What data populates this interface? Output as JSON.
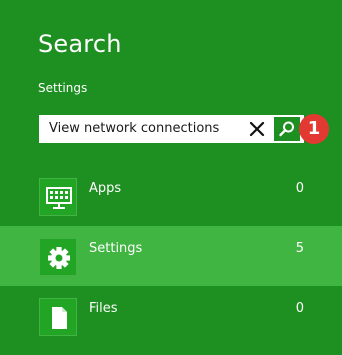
{
  "search_pane": {
    "title": "Search",
    "scope": "Settings",
    "query": "View network connections",
    "step_badge": "1"
  },
  "results": [
    {
      "label": "Apps",
      "count": "0",
      "icon": "apps-icon",
      "selected": false
    },
    {
      "label": "Settings",
      "count": "5",
      "icon": "gear-icon",
      "selected": true
    },
    {
      "label": "Files",
      "count": "0",
      "icon": "file-icon",
      "selected": false
    }
  ],
  "colors": {
    "background": "#1e8f21",
    "selected_row": "#40b542",
    "tile": "#22a524",
    "badge": "#e23a32"
  }
}
